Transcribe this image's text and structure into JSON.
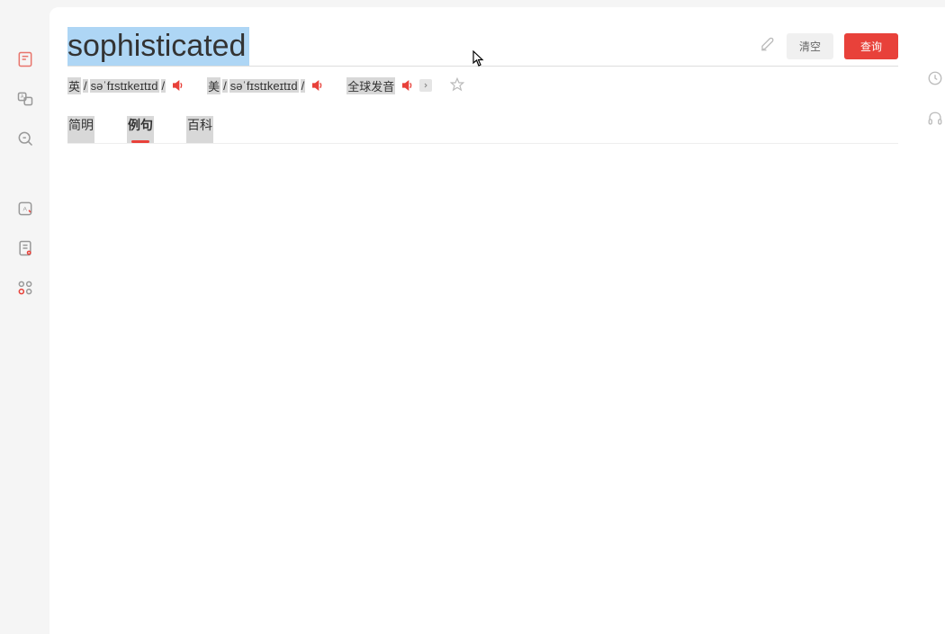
{
  "search": {
    "word": "sophisticated",
    "clear_label": "清空",
    "query_label": "查询"
  },
  "pronunciation": {
    "uk_lang": "英",
    "uk_ipa": "səˈfɪstɪkeɪtɪd",
    "us_lang": "美",
    "us_ipa": "səˈfɪstɪkeɪtɪd",
    "global_label": "全球发音",
    "slash": "/"
  },
  "tabs": {
    "concise": "简明",
    "examples": "例句",
    "encyclopedia": "百科"
  }
}
